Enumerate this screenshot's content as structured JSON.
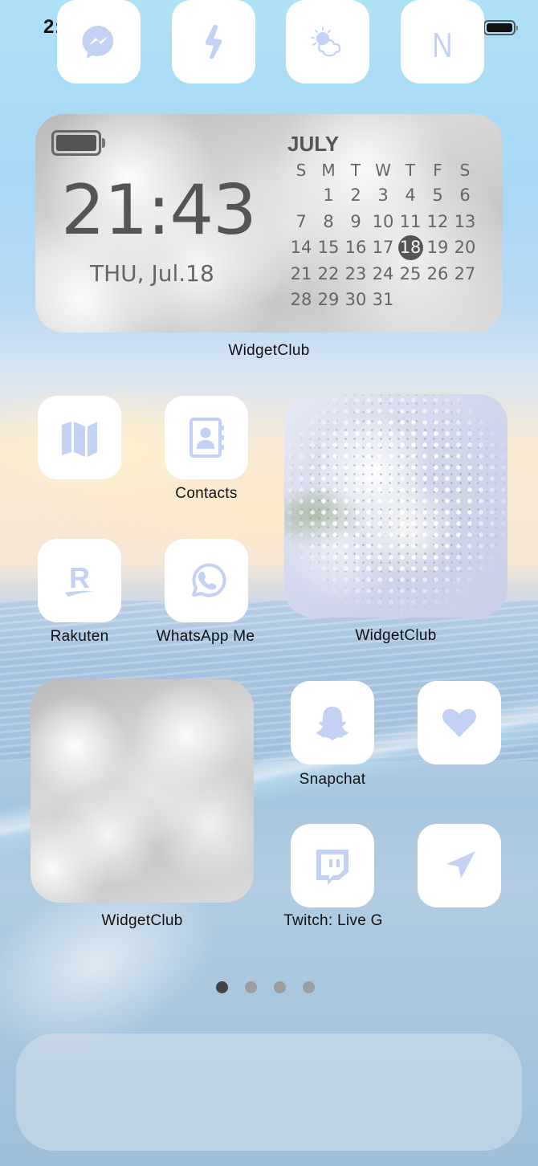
{
  "status_bar": {
    "time": "2:41",
    "signal_icon": "cellular-signal-icon",
    "wifi_icon": "wifi-icon",
    "battery_icon": "battery-full-icon"
  },
  "clock_calendar_widget": {
    "time": "21:43",
    "date": "THU, Jul.18",
    "battery_icon": "battery-icon",
    "month": "JULY",
    "weekdays": [
      "S",
      "M",
      "T",
      "W",
      "T",
      "F",
      "S"
    ],
    "leading_blanks": 1,
    "days": [
      "1",
      "2",
      "3",
      "4",
      "5",
      "6",
      "7",
      "8",
      "9",
      "10",
      "11",
      "12",
      "13",
      "14",
      "15",
      "16",
      "17",
      "18",
      "19",
      "20",
      "21",
      "22",
      "23",
      "24",
      "25",
      "26",
      "27",
      "28",
      "29",
      "30",
      "31"
    ],
    "today": "18",
    "label": "WidgetClub"
  },
  "apps": [
    {
      "name": "maps",
      "label": "",
      "icon": "map-icon"
    },
    {
      "name": "contacts",
      "label": "Contacts",
      "icon": "contacts-book-icon"
    },
    {
      "name": "rakuten",
      "label": "Rakuten",
      "icon": "rakuten-r-icon"
    },
    {
      "name": "whatsapp",
      "label": "WhatsApp Me",
      "icon": "whatsapp-icon"
    },
    {
      "name": "snapchat",
      "label": "Snapchat",
      "icon": "snapchat-ghost-icon"
    },
    {
      "name": "health",
      "label": "",
      "icon": "heart-icon"
    },
    {
      "name": "twitch",
      "label": "Twitch: Live G",
      "icon": "twitch-icon"
    },
    {
      "name": "navigation",
      "label": "",
      "icon": "location-arrow-icon"
    }
  ],
  "photo_widgets": [
    {
      "label": "WidgetClub",
      "content": "baby's breath flowers photo"
    },
    {
      "label": "WidgetClub",
      "content": "white clouds photo"
    }
  ],
  "page_indicator": {
    "total": 4,
    "current": 1
  },
  "dock": [
    {
      "name": "messenger",
      "icon": "messenger-icon"
    },
    {
      "name": "flash",
      "icon": "lightning-bolt-icon"
    },
    {
      "name": "weather",
      "icon": "sun-cloud-icon"
    },
    {
      "name": "netflix",
      "icon": "letter-n-icon",
      "glyph": "N"
    }
  ],
  "colors": {
    "icon_tint": "#c3d1f5",
    "icon_bg": "#ffffff",
    "widget_text": "#555555",
    "label_text": "#111111"
  }
}
